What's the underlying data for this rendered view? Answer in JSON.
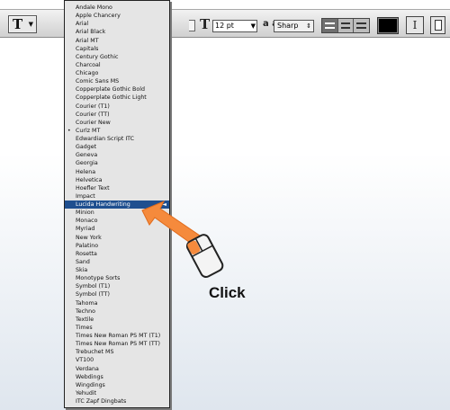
{
  "toolbar": {
    "tool_glyph": "T",
    "size_label_glyph": "T",
    "font_size": "12 pt",
    "antialias_icon": "a a",
    "antialias_value": "Sharp",
    "alignment": [
      "left",
      "center",
      "right"
    ],
    "alignment_selected": "left",
    "text_color": "#000000",
    "warp_glyph": "I"
  },
  "font_menu": {
    "items": [
      "Andale Mono",
      "Apple Chancery",
      "Arial",
      "Arial Black",
      "Arial MT",
      "Capitals",
      "Century Gothic",
      "Charcoal",
      "Chicago",
      "Comic Sans MS",
      "Copperplate Gothic Bold",
      "Copperplate Gothic Light",
      "Courier (T1)",
      "Courier (TT)",
      "Courier New",
      "Curlz MT",
      "Edwardian Script ITC",
      "Gadget",
      "Geneva",
      "Georgia",
      "Helena",
      "Helvetica",
      "Hoefler Text",
      "Impact",
      "Lucida Handwriting",
      "Minion",
      "Monaco",
      "Myriad",
      "New York",
      "Palatino",
      "Rosetta",
      "Sand",
      "Skia",
      "Monotype Sorts",
      "Symbol (T1)",
      "Symbol (TT)",
      "Tahoma",
      "Techno",
      "Textile",
      "Times",
      "Times New Roman PS MT (T1)",
      "Times New Roman PS MT (TT)",
      "Trebuchet MS",
      "VT100",
      "Verdana",
      "Webdings",
      "Wingdings",
      "Yehudit",
      "ITC Zapf Dingbats"
    ],
    "checked_item": "Curlz MT",
    "highlighted_item": "Lucida Handwriting"
  },
  "annotation": {
    "click_label": "Click",
    "arrow_color": "#f58a3c"
  }
}
